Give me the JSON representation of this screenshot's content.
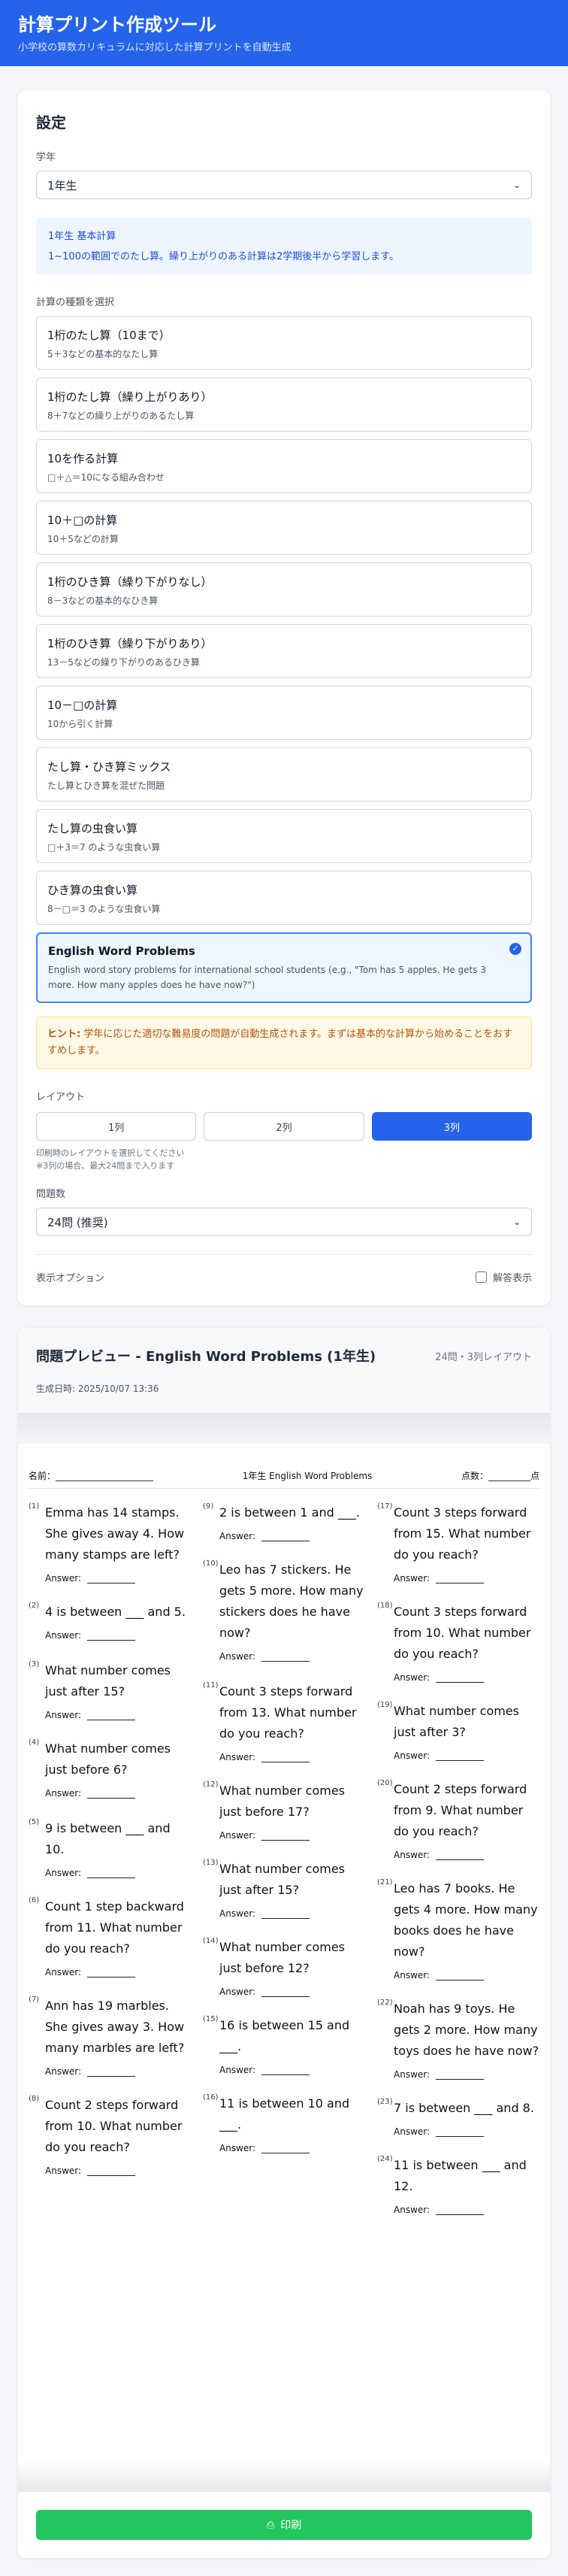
{
  "header": {
    "title": "計算プリント作成ツール",
    "subtitle": "小学校の算数カリキュラムに対応した計算プリントを自動生成"
  },
  "settings": {
    "heading": "設定",
    "grade_label": "学年",
    "grade_value": "1年生",
    "info_title": "1年生 基本計算",
    "info_desc": "1~100の範囲でのたし算。繰り上がりのある計算は2学期後半から学習します。",
    "types_label": "計算の種類を選択",
    "types": [
      {
        "name": "1桁のたし算（10まで）",
        "desc": "5＋3などの基本的なたし算"
      },
      {
        "name": "1桁のたし算（繰り上がりあり）",
        "desc": "8＋7などの繰り上がりのあるたし算"
      },
      {
        "name": "10を作る計算",
        "desc": "□＋△＝10になる組み合わせ"
      },
      {
        "name": "10＋□の計算",
        "desc": "10＋5などの計算"
      },
      {
        "name": "1桁のひき算（繰り下がりなし）",
        "desc": "8－3などの基本的なひき算"
      },
      {
        "name": "1桁のひき算（繰り下がりあり）",
        "desc": "13－5などの繰り下がりのあるひき算"
      },
      {
        "name": "10－□の計算",
        "desc": "10から引く計算"
      },
      {
        "name": "たし算・ひき算ミックス",
        "desc": "たし算とひき算を混ぜた問題"
      },
      {
        "name": "たし算の虫食い算",
        "desc": "□＋3＝7 のような虫食い算"
      },
      {
        "name": "ひき算の虫食い算",
        "desc": "8－□＝3 のような虫食い算"
      }
    ],
    "selected_type": {
      "name": "English Word Problems",
      "desc": "English word story problems for international school students (e.g., \"Tom has 5 apples. He gets 3 more. How many apples does he have now?\")"
    },
    "hint_prefix": "ヒント:",
    "hint_text": "学年に応じた適切な難易度の問題が自動生成されます。まずは基本的な計算から始めることをおすすめします。",
    "layout_label": "レイアウト",
    "layout_options": [
      "1列",
      "2列",
      "3列"
    ],
    "layout_selected": "3列",
    "layout_note1": "印刷時のレイアウトを選択してください",
    "layout_note2": "※3列の場合、最大24問まで入ります",
    "count_label": "問題数",
    "count_value": "24問 (推奨)",
    "display_label": "表示オプション",
    "show_answers_label": "解答表示",
    "show_answers": false
  },
  "preview": {
    "title": "問題プレビュー - English Word Problems (1年生)",
    "meta": "24問・3列レイアウト",
    "generated": "生成日時: 2025/10/07 13:36",
    "name_label": "名前：",
    "sheet_title": "1年生 English Word Problems",
    "score_label": "点数：",
    "score_unit": "点",
    "answer_label": "Answer:",
    "columns": [
      [
        {
          "n": "(1)",
          "q": "Emma has 14 stamps. She gives away 4. How many stamps are left?"
        },
        {
          "n": "(2)",
          "q": "4 is between ___ and 5."
        },
        {
          "n": "(3)",
          "q": "What number comes just after 15?"
        },
        {
          "n": "(4)",
          "q": "What number comes just before 6?"
        },
        {
          "n": "(5)",
          "q": "9 is between ___ and 10."
        },
        {
          "n": "(6)",
          "q": "Count 1 step backward from 11. What number do you reach?"
        },
        {
          "n": "(7)",
          "q": "Ann has 19 marbles. She gives away 3. How many marbles are left?"
        },
        {
          "n": "(8)",
          "q": "Count 2 steps forward from 10. What number do you reach?"
        }
      ],
      [
        {
          "n": "(9)",
          "q": "2 is between 1 and ___."
        },
        {
          "n": "(10)",
          "q": "Leo has 7 stickers. He gets 5 more. How many stickers does he have now?"
        },
        {
          "n": "(11)",
          "q": "Count 3 steps forward from 13. What number do you reach?"
        },
        {
          "n": "(12)",
          "q": "What number comes just before 17?"
        },
        {
          "n": "(13)",
          "q": "What number comes just after 15?"
        },
        {
          "n": "(14)",
          "q": "What number comes just before 12?"
        },
        {
          "n": "(15)",
          "q": "16 is between 15 and ___."
        },
        {
          "n": "(16)",
          "q": "11 is between 10 and ___."
        }
      ],
      [
        {
          "n": "(17)",
          "q": "Count 3 steps forward from 15. What number do you reach?"
        },
        {
          "n": "(18)",
          "q": "Count 3 steps forward from 10. What number do you reach?"
        },
        {
          "n": "(19)",
          "q": "What number comes just after 3?"
        },
        {
          "n": "(20)",
          "q": "Count 2 steps forward from 9. What number do you reach?"
        },
        {
          "n": "(21)",
          "q": "Leo has 7 books. He gets 4 more. How many books does he have now?"
        },
        {
          "n": "(22)",
          "q": "Noah has 9 toys. He gets 2 more. How many toys does he have now?"
        },
        {
          "n": "(23)",
          "q": "7 is between ___ and 8."
        },
        {
          "n": "(24)",
          "q": "11 is between ___ and 12."
        }
      ]
    ],
    "print_label": "印刷"
  }
}
